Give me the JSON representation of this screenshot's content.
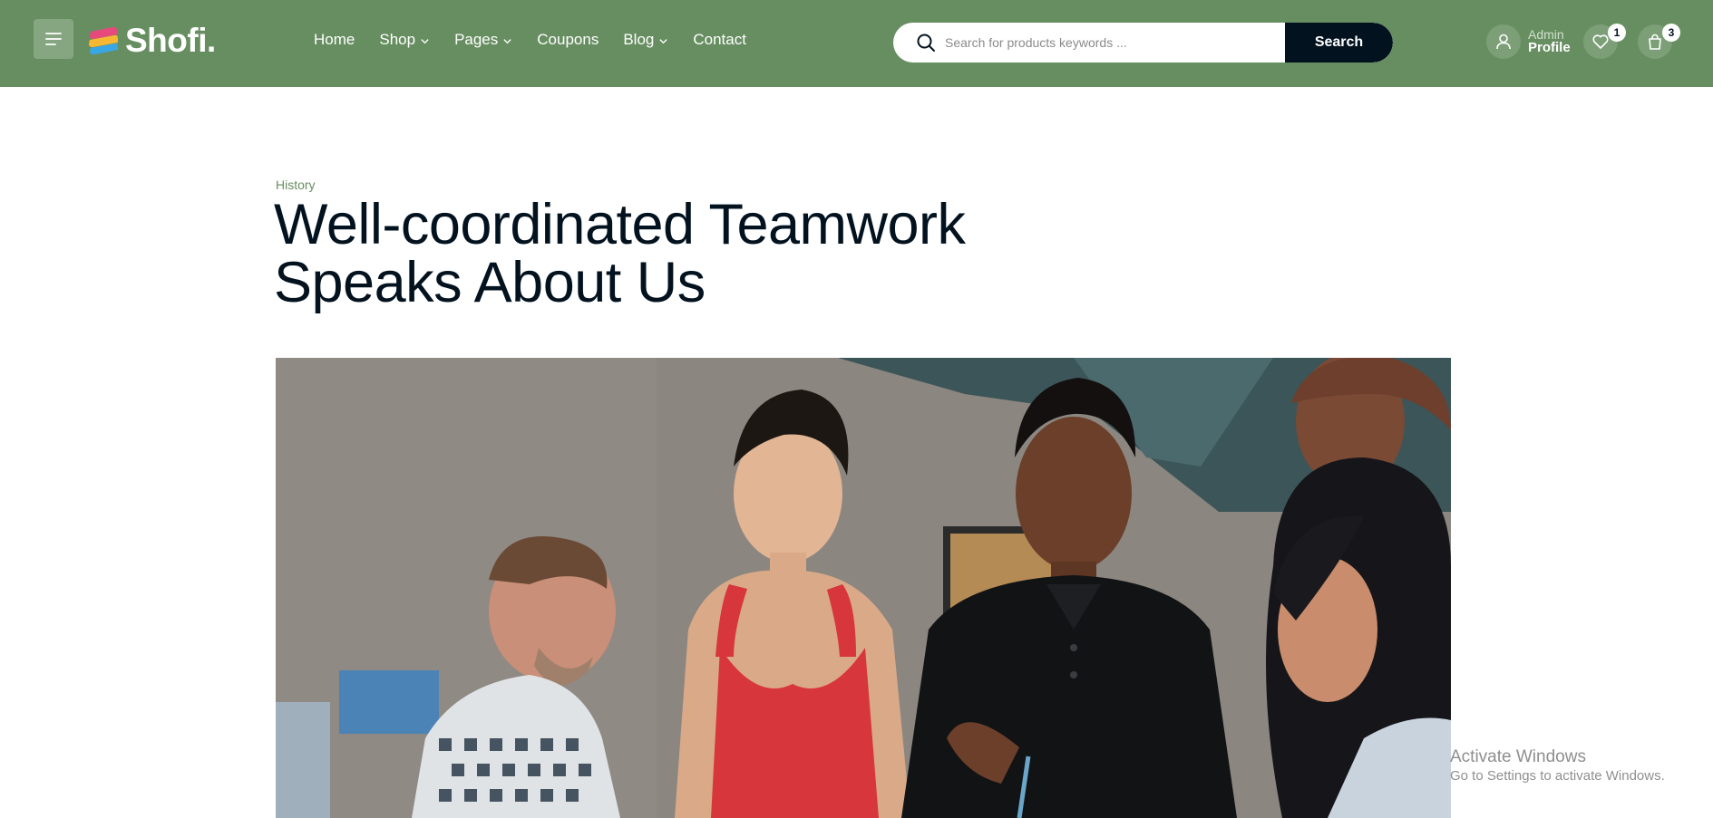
{
  "brand": {
    "name": "Shofi."
  },
  "nav": {
    "items": [
      {
        "label": "Home",
        "dropdown": false
      },
      {
        "label": "Shop",
        "dropdown": true
      },
      {
        "label": "Pages",
        "dropdown": true
      },
      {
        "label": "Coupons",
        "dropdown": false
      },
      {
        "label": "Blog",
        "dropdown": true
      },
      {
        "label": "Contact",
        "dropdown": false
      }
    ]
  },
  "search": {
    "placeholder": "Search for products keywords ...",
    "value": "",
    "button_label": "Search"
  },
  "account": {
    "greeting": "Admin",
    "label": "Profile",
    "wishlist_count": "1",
    "cart_count": "3"
  },
  "post": {
    "category": "History",
    "title": "Well-coordinated Teamwork Speaks About Us"
  },
  "os_watermark": {
    "title": "Activate Windows",
    "subtitle": "Go to Settings to activate Windows."
  },
  "colors": {
    "header_bg": "#678e61",
    "accent": "#678e61",
    "search_button": "#03121f",
    "heading": "#03121f"
  }
}
